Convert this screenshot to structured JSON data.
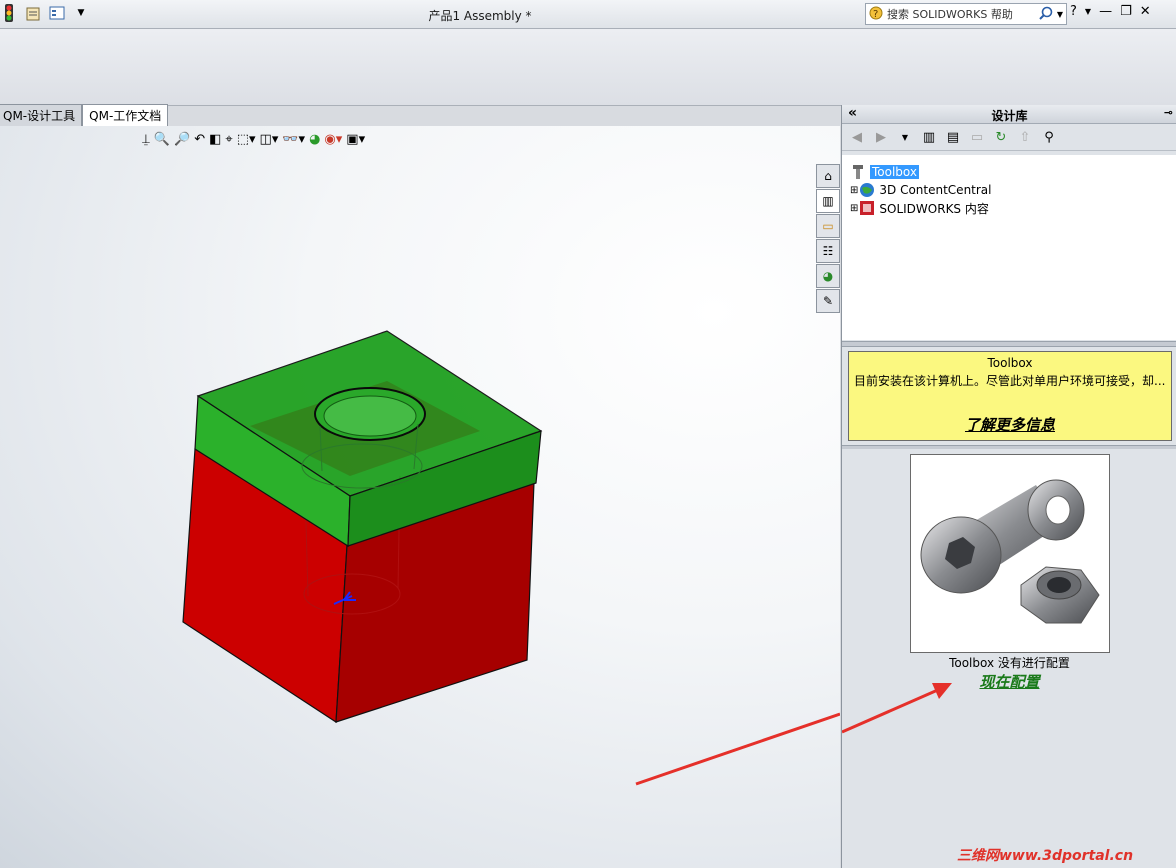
{
  "titlebar": {
    "title": "产品1 Assembly *",
    "search_placeholder": "搜索 SOLIDWORKS 帮助",
    "icons": [
      "traffic-light-icon",
      "file-properties-icon",
      "options-icon",
      "dropdown-icon"
    ]
  },
  "tabs": [
    {
      "label": "QM-设计工具",
      "active": false
    },
    {
      "label": "QM-工作文档",
      "active": true
    }
  ],
  "heads_up_toolbar": [
    "view-orientation-icon",
    "zoom-to-fit-icon",
    "zoom-area-icon",
    "previous-view-icon",
    "section-view-icon",
    "dynamic-annotation-icon",
    "view-orientation-cube-icon",
    "display-style-icon",
    "hide-show-icon",
    "edit-appearance-icon",
    "apply-scene-icon",
    "view-settings-icon"
  ],
  "task_pane_tabs": [
    "home-icon",
    "design-library-icon",
    "file-explorer-icon",
    "view-palette-icon",
    "appearances-icon",
    "custom-properties-icon"
  ],
  "design_library": {
    "title": "设计库",
    "tree": [
      {
        "label": "Toolbox",
        "selected": true,
        "icon": "toolbox-icon"
      },
      {
        "label": "3D ContentCentral",
        "selected": false,
        "icon": "globe-icon"
      },
      {
        "label": "SOLIDWORKS 内容",
        "selected": false,
        "icon": "sw-content-icon"
      }
    ],
    "info": {
      "heading": "Toolbox",
      "body": "目前安装在该计算机上。尽管此对单用户环境可接受，却...",
      "link": "了解更多信息"
    },
    "preview_caption": "Toolbox 没有进行配置",
    "configure_link": "现在配置"
  },
  "watermark": "三维网www.3dportal.cn",
  "colors": {
    "cube_top": "#1fa01f",
    "cube_body": "#cc0000",
    "selection": "#3399ff",
    "info_bg": "#fbf880",
    "link_green": "#1a7a1a",
    "arrow": "#e5302a"
  }
}
